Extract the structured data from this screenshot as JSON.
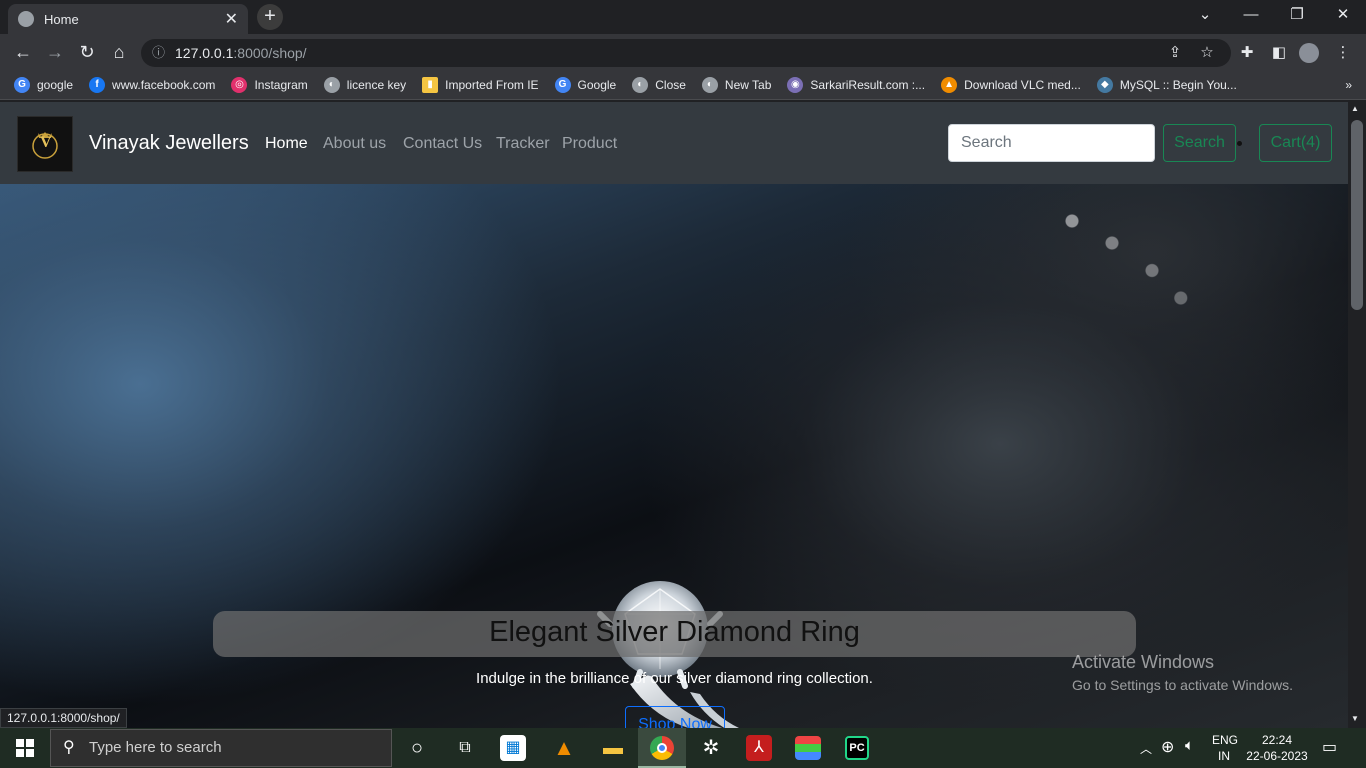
{
  "browser": {
    "tab_title": "Home",
    "url_host": "127.0.0.1",
    "url_rest": ":8000/shop/",
    "bookmarks": [
      {
        "label": "google",
        "color": "#4285f4",
        "glyph": "G"
      },
      {
        "label": "www.facebook.com",
        "color": "#1877f2",
        "glyph": "f"
      },
      {
        "label": "Instagram",
        "color": "#e1306c",
        "glyph": "◎"
      },
      {
        "label": "licence key",
        "color": "#9aa0a6",
        "glyph": "◐"
      },
      {
        "label": "Imported From IE",
        "color": "#f5c542",
        "glyph": "▮"
      },
      {
        "label": "Google",
        "color": "#4285f4",
        "glyph": "G"
      },
      {
        "label": "Close",
        "color": "#9aa0a6",
        "glyph": "◐"
      },
      {
        "label": "New Tab",
        "color": "#9aa0a6",
        "glyph": "◐"
      },
      {
        "label": "SarkariResult.com :...",
        "color": "#7b6fb5",
        "glyph": "◉"
      },
      {
        "label": "Download VLC med...",
        "color": "#f08c00",
        "glyph": "▲"
      },
      {
        "label": "MySQL :: Begin You...",
        "color": "#4479a1",
        "glyph": "◆"
      }
    ],
    "status_url": "127.0.0.1:8000/shop/"
  },
  "site": {
    "brand": "Vinayak Jewellers",
    "logo_letter": "V",
    "nav": [
      "Home",
      "About us",
      "Contact Us",
      "Tracker",
      "Product"
    ],
    "search_placeholder": "Search",
    "search_button": "Search",
    "cart_button": "Cart(4)"
  },
  "hero": {
    "title": "Elegant Silver Diamond Ring",
    "subtitle": "Indulge in the brilliance of our silver diamond ring collection.",
    "cta": "Shop Now"
  },
  "watermark": {
    "line1": "Activate Windows",
    "line2": "Go to Settings to activate Windows."
  },
  "taskbar": {
    "search_placeholder": "Type here to search",
    "lang1": "ENG",
    "lang2": "IN",
    "time": "22:24",
    "date": "22-06-2023"
  },
  "colors": {
    "navbar": "#343a40",
    "success": "#198754",
    "primary": "#0d6efd"
  }
}
